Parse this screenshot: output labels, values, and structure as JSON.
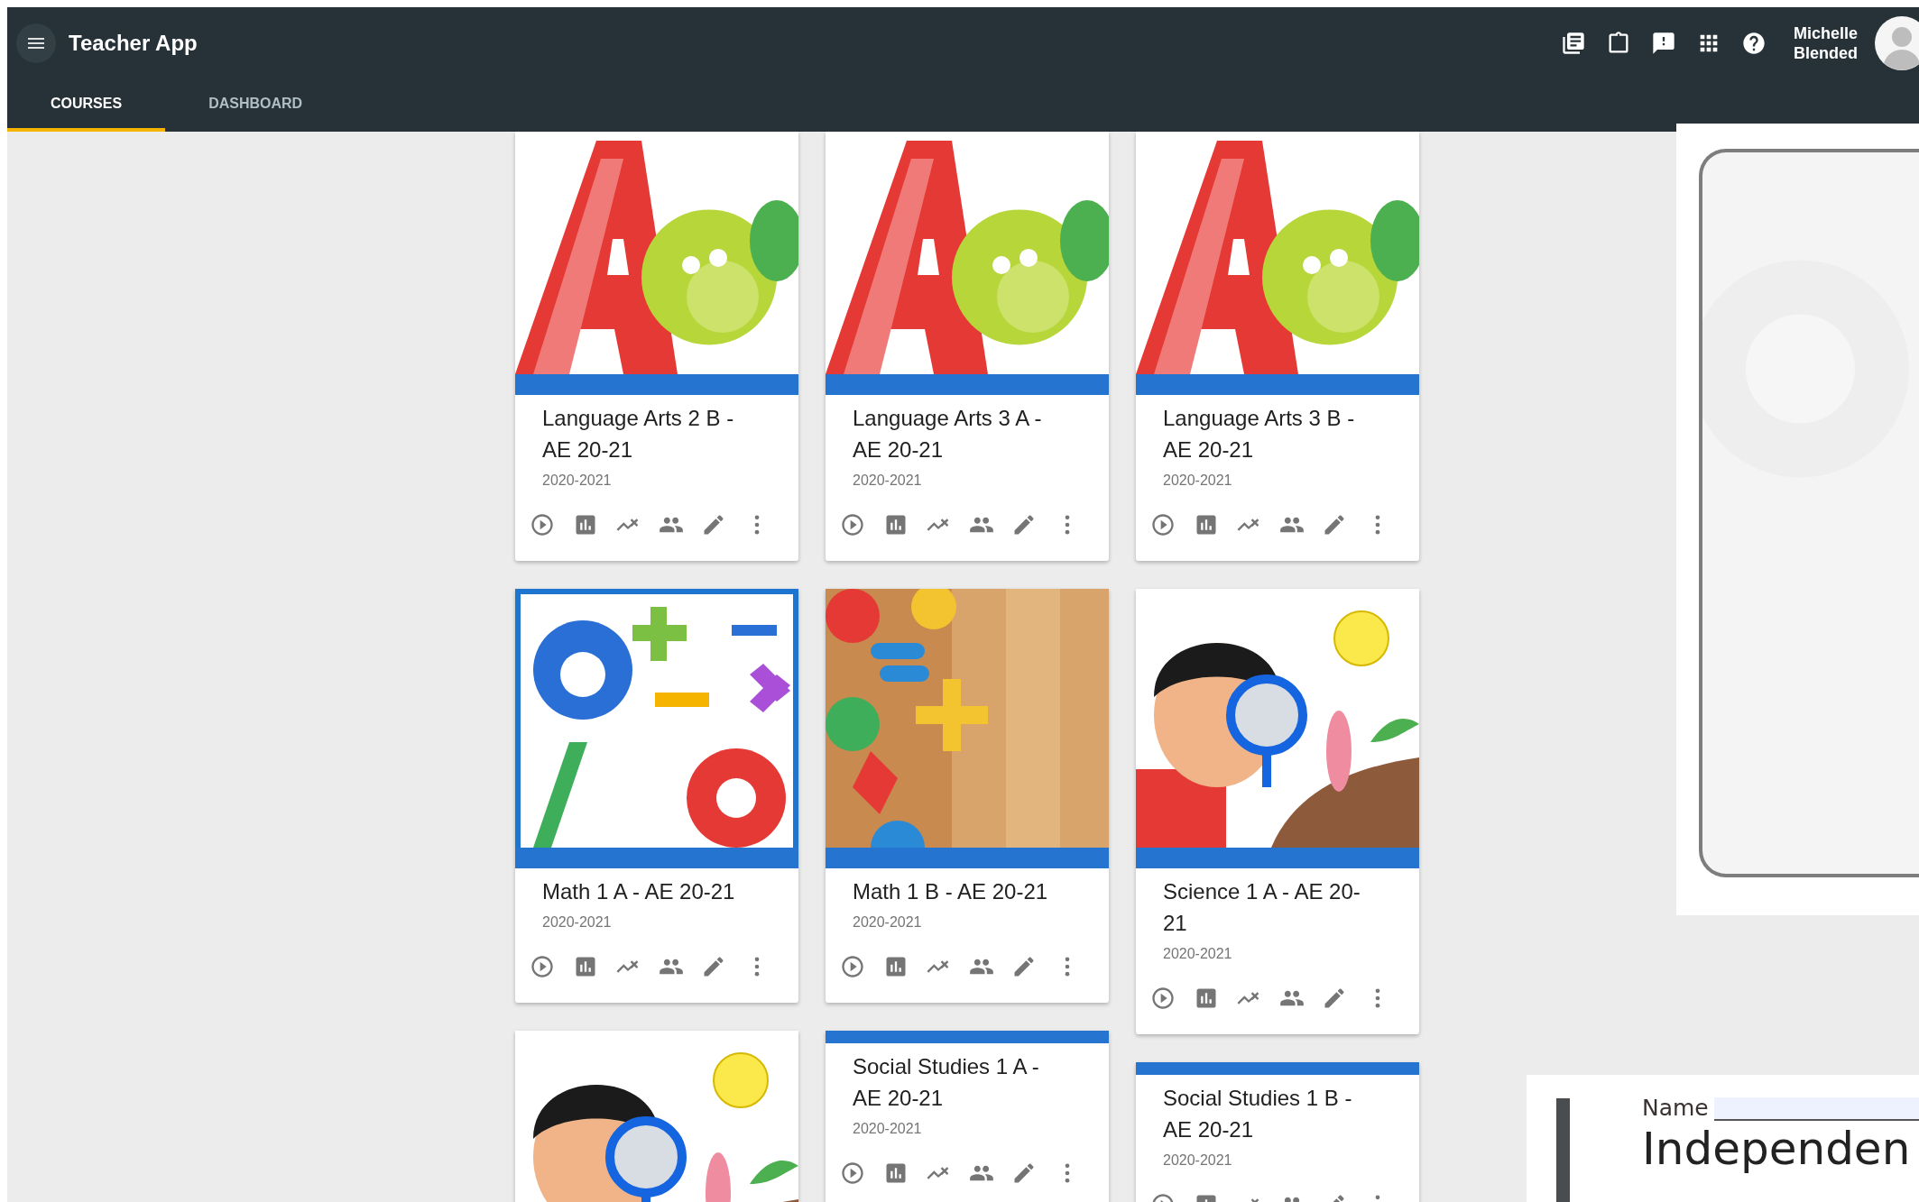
{
  "app_bar": {
    "title": "Teacher App",
    "user_name": "Michelle Blended"
  },
  "tabs": [
    {
      "label": "COURSES",
      "selected": true
    },
    {
      "label": "DASHBOARD",
      "selected": false
    }
  ],
  "course_columns": [
    {
      "cards": [
        {
          "image": {
            "kind": "picture"
          },
          "title": "Language Arts 2 B - AE 20-21",
          "term": "2020-2021"
        },
        {
          "image": {
            "kind": "picture"
          },
          "title": "Math 1 A - AE 20-21",
          "term": "2020-2021"
        },
        {
          "image": {
            "kind": "picture"
          }
        }
      ]
    },
    {
      "cards": [
        {
          "image": {
            "kind": "picture"
          },
          "title": "Language Arts 3 A - AE 20-21",
          "term": "2020-2021"
        },
        {
          "image": {
            "kind": "picture"
          },
          "title": "Math 1 B - AE 20-21",
          "term": "2020-2021"
        },
        {
          "title": "Social Studies 1 A - AE 20-21",
          "term": "2020-2021"
        }
      ]
    },
    {
      "cards": [
        {
          "image": {
            "kind": "picture"
          },
          "title": "Language Arts 3 B - AE 20-21",
          "term": "2020-2021"
        },
        {
          "image": {
            "kind": "picture"
          },
          "title": "Science 1 A - AE 20-21",
          "term": "2020-2021"
        },
        {
          "title": "Social Studies 1 B - AE 20-21",
          "term": "2020-2021"
        }
      ]
    }
  ],
  "previews": [
    {
      "kind": "frame"
    },
    {
      "kind": "worksheet",
      "name_label": "Name",
      "heading": "Independen"
    }
  ]
}
